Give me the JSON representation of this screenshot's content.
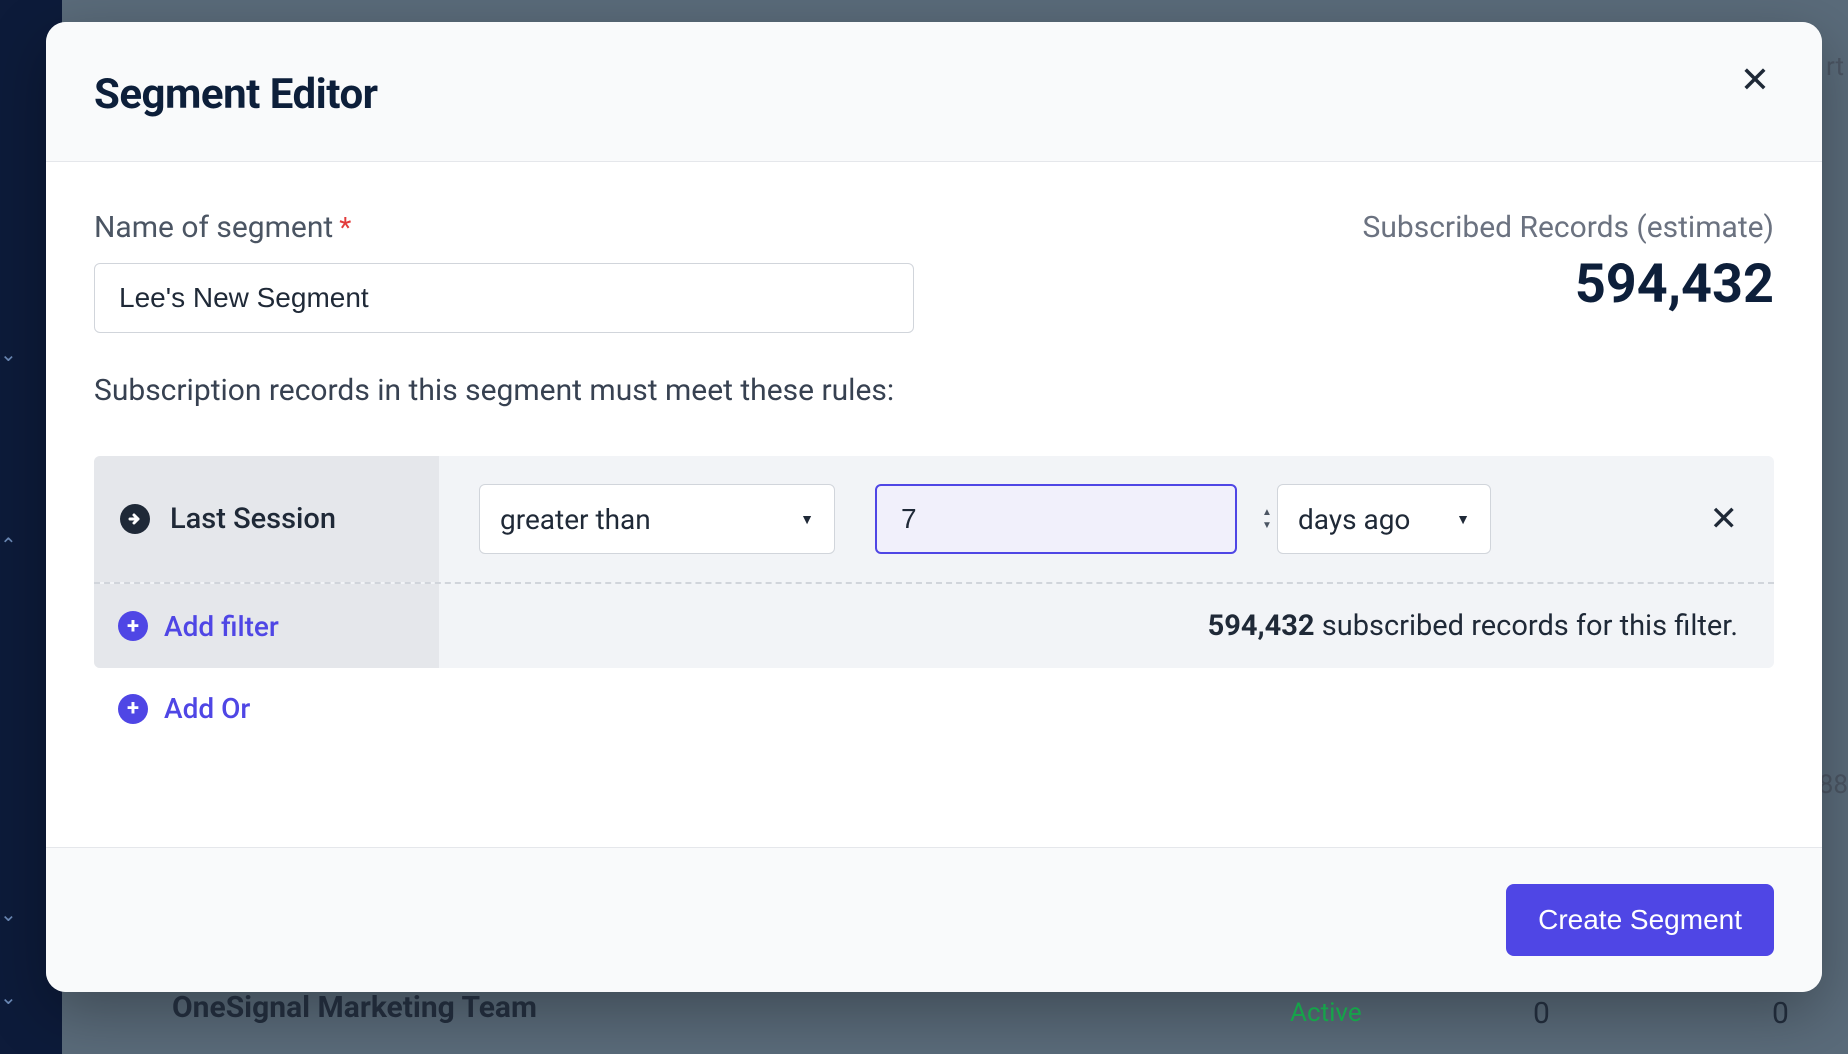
{
  "modal": {
    "title": "Segment Editor",
    "name_label": "Name of segment",
    "required_mark": "*",
    "name_value": "Lee's New Segment",
    "estimate_label": "Subscribed Records (estimate)",
    "estimate_value": "594,432",
    "rules_intro": "Subscription records in this segment must meet these rules:",
    "filter": {
      "type_label": "Last Session",
      "operator": "greater than",
      "value": "7",
      "unit": "days ago",
      "count_strong": "594,432",
      "count_rest": " subscribed records for this filter."
    },
    "add_filter_label": "Add filter",
    "add_or_label": "Add Or",
    "create_button": "Create Segment"
  },
  "background": {
    "team_label": "OneSignal Marketing Team",
    "status": "Active",
    "zero1": "0",
    "zero2": "0",
    "rt": "rt",
    "n88": "88"
  }
}
